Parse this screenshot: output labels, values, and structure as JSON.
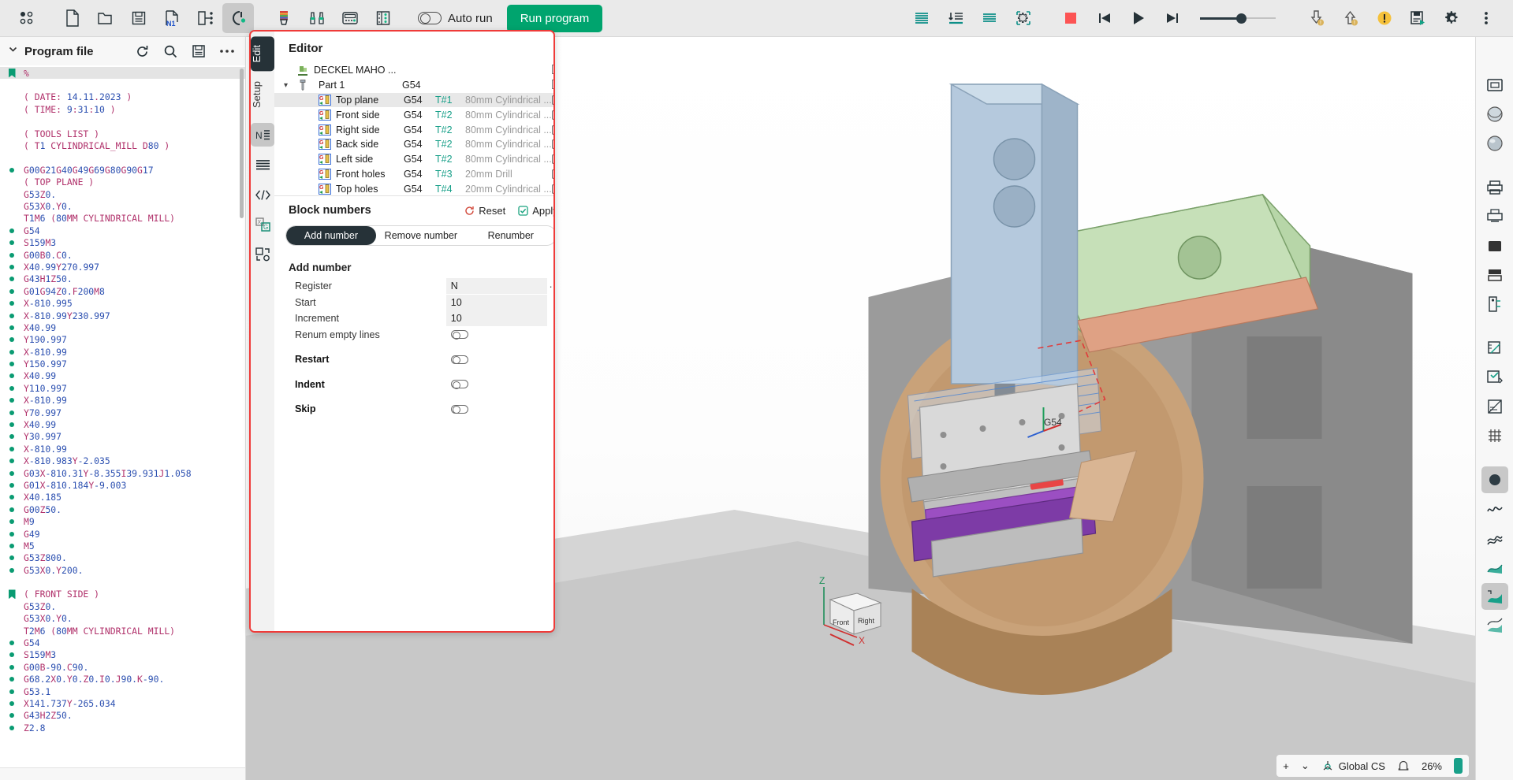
{
  "toolbar": {
    "left_icons": [
      {
        "name": "grid-dots-icon",
        "label": "Views"
      },
      {
        "name": "new-file-icon",
        "label": "New"
      },
      {
        "name": "open-folder-icon",
        "label": "Open"
      },
      {
        "name": "save-icon",
        "label": "Save"
      },
      {
        "name": "n1-block-number-icon",
        "label": "N1"
      },
      {
        "name": "export-icon",
        "label": "Export"
      },
      {
        "name": "machine-setup-icon",
        "label": "Machine setup"
      },
      {
        "name": "tool-color-icon",
        "label": "Tool"
      },
      {
        "name": "fixture-icon",
        "label": "Fixtures"
      },
      {
        "name": "control-panel-icon",
        "label": "Control panel"
      },
      {
        "name": "tool-list-icon",
        "label": "Tool list"
      }
    ],
    "auto_run_label": "Auto run",
    "run_program_label": "Run program",
    "run_color": "#00a46e",
    "right_icons": [
      {
        "name": "align-lines-icon"
      },
      {
        "name": "step-into-icon"
      },
      {
        "name": "lines-icon"
      },
      {
        "name": "gear-frame-icon"
      },
      {
        "name": "stop-icon",
        "color": "#fc5454"
      },
      {
        "name": "skip-back-icon"
      },
      {
        "name": "play-icon"
      },
      {
        "name": "skip-forward-icon"
      }
    ],
    "speed_slider": {
      "name": "speed-slider",
      "value": 52
    },
    "far_right_icons": [
      {
        "name": "download-warning-icon"
      },
      {
        "name": "upload-warning-icon"
      },
      {
        "name": "alert-icon",
        "color": "#f5c13b"
      },
      {
        "name": "save-run-icon"
      },
      {
        "name": "settings-gear-icon"
      },
      {
        "name": "more-vertical-icon"
      }
    ]
  },
  "program_panel": {
    "title": "Program file",
    "header_icons": [
      {
        "name": "refresh-icon"
      },
      {
        "name": "search-icon"
      },
      {
        "name": "save-icon"
      },
      {
        "name": "more-horizontal-icon"
      }
    ],
    "lines": [
      {
        "text": "%",
        "marker": "bookmark",
        "selected": true
      },
      {
        "text": "",
        "marker": "none"
      },
      {
        "text": "( DATE: 14.11.2023 )",
        "marker": "none"
      },
      {
        "text": "( TIME: 9:31:10 )",
        "marker": "none"
      },
      {
        "text": "",
        "marker": "none"
      },
      {
        "text": "( TOOLS LIST )",
        "marker": "none"
      },
      {
        "text": "( T1 CYLINDRICAL_MILL D80 )",
        "marker": "none"
      },
      {
        "text": "",
        "marker": "none"
      },
      {
        "text": "G00G21G40G49G69G80G90G17",
        "marker": "dot"
      },
      {
        "text": "( TOP PLANE )",
        "marker": "none"
      },
      {
        "text": "G53Z0.",
        "marker": "none"
      },
      {
        "text": "G53X0.Y0.",
        "marker": "none"
      },
      {
        "text": "T1M6 (80MM CYLINDRICAL MILL)",
        "marker": "none"
      },
      {
        "text": "G54",
        "marker": "dot"
      },
      {
        "text": "S159M3",
        "marker": "dot"
      },
      {
        "text": "G00B0.C0.",
        "marker": "dot"
      },
      {
        "text": "X40.99Y270.997",
        "marker": "dot"
      },
      {
        "text": "G43H1Z50.",
        "marker": "dot"
      },
      {
        "text": "G01G94Z0.F200M8",
        "marker": "dot"
      },
      {
        "text": "X-810.995",
        "marker": "dot"
      },
      {
        "text": "X-810.99Y230.997",
        "marker": "dot"
      },
      {
        "text": "X40.99",
        "marker": "dot"
      },
      {
        "text": "Y190.997",
        "marker": "dot"
      },
      {
        "text": "X-810.99",
        "marker": "dot"
      },
      {
        "text": "Y150.997",
        "marker": "dot"
      },
      {
        "text": "X40.99",
        "marker": "dot"
      },
      {
        "text": "Y110.997",
        "marker": "dot"
      },
      {
        "text": "X-810.99",
        "marker": "dot"
      },
      {
        "text": "Y70.997",
        "marker": "dot"
      },
      {
        "text": "X40.99",
        "marker": "dot"
      },
      {
        "text": "Y30.997",
        "marker": "dot"
      },
      {
        "text": "X-810.99",
        "marker": "dot"
      },
      {
        "text": "X-810.983Y-2.035",
        "marker": "dot"
      },
      {
        "text": "G03X-810.31Y-8.355I39.931J1.058",
        "marker": "dot"
      },
      {
        "text": "G01X-810.184Y-9.003",
        "marker": "dot"
      },
      {
        "text": "X40.185",
        "marker": "dot"
      },
      {
        "text": "G00Z50.",
        "marker": "dot"
      },
      {
        "text": "M9",
        "marker": "dot"
      },
      {
        "text": "G49",
        "marker": "dot"
      },
      {
        "text": "M5",
        "marker": "dot"
      },
      {
        "text": "G53Z800.",
        "marker": "dot"
      },
      {
        "text": "G53X0.Y200.",
        "marker": "dot"
      },
      {
        "text": "",
        "marker": "none"
      },
      {
        "text": "( FRONT SIDE )",
        "marker": "bookmark"
      },
      {
        "text": "G53Z0.",
        "marker": "none"
      },
      {
        "text": "G53X0.Y0.",
        "marker": "none"
      },
      {
        "text": "T2M6 (80MM CYLINDRICAL MILL)",
        "marker": "none"
      },
      {
        "text": "G54",
        "marker": "dot"
      },
      {
        "text": "S159M3",
        "marker": "dot"
      },
      {
        "text": "G00B-90.C90.",
        "marker": "dot"
      },
      {
        "text": "G68.2X0.Y0.Z0.I0.J90.K-90.",
        "marker": "dot"
      },
      {
        "text": "G53.1",
        "marker": "dot"
      },
      {
        "text": "X141.737Y-265.034",
        "marker": "dot"
      },
      {
        "text": "G43H2Z50.",
        "marker": "dot"
      },
      {
        "text": "Z2.8",
        "marker": "dot"
      }
    ]
  },
  "editor": {
    "vtabs": [
      {
        "name": "tab-edit",
        "label": "Edit",
        "active": true
      },
      {
        "name": "tab-setup",
        "label": "Setup",
        "active": false
      }
    ],
    "vicons": [
      {
        "name": "block-numbers-icon",
        "active": true
      },
      {
        "name": "line-format-icon",
        "active": false
      },
      {
        "name": "code-tags-icon",
        "active": false
      },
      {
        "name": "replace-icon",
        "active": false
      },
      {
        "name": "transform-icon",
        "active": false
      }
    ],
    "title": "Editor",
    "machine": "DECKEL MAHO ...",
    "part": {
      "name": "Part 1",
      "wcs": "G54"
    },
    "tree_columns": [
      "name",
      "wcs",
      "tool",
      "description"
    ],
    "operations": [
      {
        "name": "Top plane",
        "wcs": "G54",
        "tool": "T#1",
        "desc": "80mm Cylindrical ...",
        "checked": true,
        "selected": true
      },
      {
        "name": "Front side",
        "wcs": "G54",
        "tool": "T#2",
        "desc": "80mm Cylindrical ...",
        "checked": true,
        "selected": false
      },
      {
        "name": "Right side",
        "wcs": "G54",
        "tool": "T#2",
        "desc": "80mm Cylindrical ...",
        "checked": true,
        "selected": false
      },
      {
        "name": "Back side",
        "wcs": "G54",
        "tool": "T#2",
        "desc": "80mm Cylindrical ...",
        "checked": true,
        "selected": false
      },
      {
        "name": "Left side",
        "wcs": "G54",
        "tool": "T#2",
        "desc": "80mm Cylindrical ...",
        "checked": true,
        "selected": false
      },
      {
        "name": "Front holes",
        "wcs": "G54",
        "tool": "T#3",
        "desc": "20mm Drill",
        "checked": true,
        "selected": false
      },
      {
        "name": "Top holes",
        "wcs": "G54",
        "tool": "T#4",
        "desc": "20mm Cylindrical ...",
        "checked": true,
        "selected": false
      }
    ],
    "block_numbers": {
      "title": "Block numbers",
      "reset_label": "Reset",
      "apply_label": "Apply",
      "tabs": [
        {
          "label": "Add number",
          "active": true
        },
        {
          "label": "Remove number",
          "active": false
        },
        {
          "label": "Renumber",
          "active": false
        }
      ],
      "section_title": "Add number",
      "fields": [
        {
          "label": "Register",
          "value": "N",
          "type": "text",
          "menu": true
        },
        {
          "label": "Start",
          "value": "10",
          "type": "text",
          "menu": false
        },
        {
          "label": "Increment",
          "value": "10",
          "type": "text",
          "menu": false
        },
        {
          "label": "Renum empty lines",
          "value": "",
          "type": "toggle",
          "on": false,
          "bold": false
        },
        {
          "label": "Restart",
          "value": "",
          "type": "toggle",
          "on": false,
          "bold": true
        },
        {
          "label": "Indent",
          "value": "",
          "type": "toggle",
          "on": false,
          "bold": true
        },
        {
          "label": "Skip",
          "value": "",
          "type": "toggle",
          "on": false,
          "bold": true
        }
      ]
    }
  },
  "viewport": {
    "wcs_label": "G54",
    "axis_labels": {
      "z": "Z",
      "x": "X"
    },
    "view_cube": {
      "front": "Front",
      "right": "Right"
    },
    "status": {
      "add_label": "+",
      "chevron": "⌄",
      "cs_label": "Global CS",
      "bell": "bell-icon",
      "zoom": "26%"
    }
  },
  "right_rail": {
    "icons": [
      {
        "name": "machine-view-icon",
        "active": false
      },
      {
        "name": "sphere-shaded-icon",
        "active": false
      },
      {
        "name": "sphere-smooth-icon",
        "active": false
      },
      {
        "name": "print-icon",
        "active": false
      },
      {
        "name": "print-alt-icon",
        "active": false
      },
      {
        "name": "box-solid-icon",
        "active": false
      },
      {
        "name": "box-layers-icon",
        "active": false
      },
      {
        "name": "stock-icon",
        "active": false
      },
      {
        "name": "measure-icon",
        "active": false
      },
      {
        "name": "compare-icon",
        "active": false
      },
      {
        "name": "section-icon",
        "active": false
      },
      {
        "name": "grid-icon",
        "active": false
      },
      {
        "name": "point-dot-icon",
        "active": true
      },
      {
        "name": "wave-icon",
        "active": false
      },
      {
        "name": "surface-icon",
        "active": false
      },
      {
        "name": "surface-green-icon",
        "active": false
      },
      {
        "name": "surface-green2-icon",
        "active": true
      },
      {
        "name": "surface-green3-icon",
        "active": false
      }
    ]
  }
}
